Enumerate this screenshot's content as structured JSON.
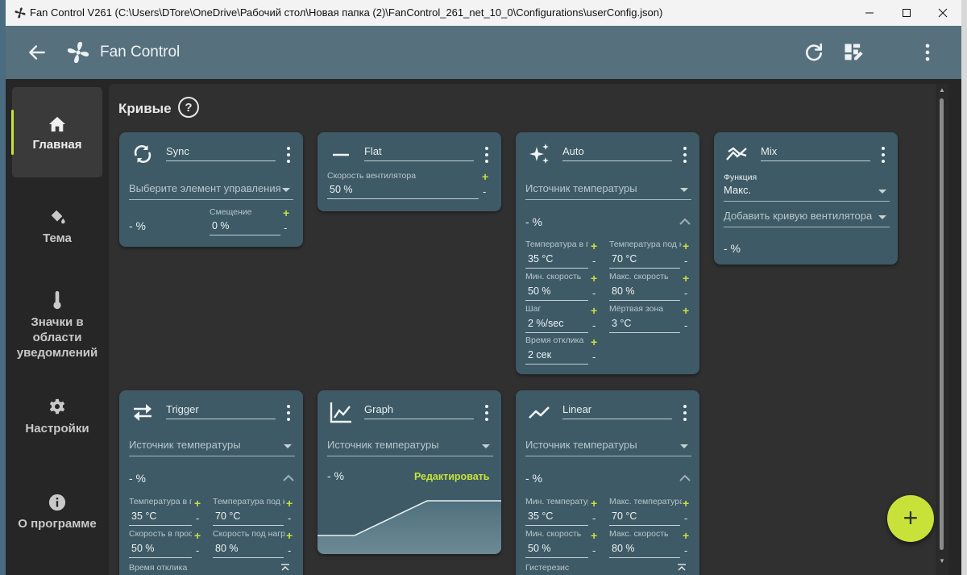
{
  "window": {
    "title": "Fan Control V261 (C:\\Users\\DTore\\OneDrive\\Рабочий стол\\Новая папка (2)\\FanControl_261_net_10_0\\Configurations\\userConfig.json)"
  },
  "appbar": {
    "title": "Fan Control"
  },
  "sidebar": {
    "items": [
      {
        "label": "Главная",
        "icon": "home-icon"
      },
      {
        "label": "Тема",
        "icon": "paint-bucket-icon"
      },
      {
        "label": "Значки в области уведомлений",
        "icon": "thermometer-icon"
      },
      {
        "label": "Настройки",
        "icon": "gear-icon"
      },
      {
        "label": "О программе",
        "icon": "info-icon"
      }
    ]
  },
  "main": {
    "heading": "Кривые",
    "help": "?"
  },
  "cards": {
    "sync": {
      "name": "Sync",
      "control_placeholder": "Выберите элемент управления",
      "pct": "- %",
      "offset_label": "Смещение",
      "offset_value": "0 %"
    },
    "flat": {
      "name": "Flat",
      "speed_label": "Скорость вентилятора",
      "speed_value": "50 %"
    },
    "auto": {
      "name": "Auto",
      "source_placeholder": "Источник температуры",
      "pct": "- %",
      "temp_idle_label": "Температура в г",
      "temp_idle_value": "35 °C",
      "temp_load_label": "Температура под н",
      "temp_load_value": "70 °C",
      "min_speed_label": "Мин. скорость",
      "min_speed_value": "50 %",
      "max_speed_label": "Макс. скорость",
      "max_speed_value": "80 %",
      "step_label": "Шаг",
      "step_value": "2 %/sec",
      "deadband_label": "Мёртвая зона",
      "deadband_value": "3 °C",
      "response_label": "Время отклика",
      "response_value": "2 сек"
    },
    "mix": {
      "name": "Mix",
      "function_label": "Функция",
      "function_value": "Макс.",
      "add_curve_placeholder": "Добавить кривую вентилятора",
      "pct": "- %"
    },
    "trigger": {
      "name": "Trigger",
      "source_placeholder": "Источник температуры",
      "pct": "- %",
      "temp_idle_label": "Температура в п",
      "temp_idle_value": "35 °C",
      "temp_load_label": "Температура под н",
      "temp_load_value": "70 °C",
      "speed_idle_label": "Скорость в прос",
      "speed_idle_value": "50 %",
      "speed_load_label": "Скорость под нагр",
      "speed_load_value": "80 %",
      "response_label": "Время отклика"
    },
    "graph": {
      "name": "Graph",
      "source_placeholder": "Источник температуры",
      "pct": "- %",
      "edit_label": "Редактировать"
    },
    "linear": {
      "name": "Linear",
      "source_placeholder": "Источник температуры",
      "pct": "- %",
      "min_temp_label": "Мин. температура",
      "min_temp_value": "35 °C",
      "max_temp_label": "Макс. температура",
      "max_temp_value": "70 °C",
      "min_speed_label": "Мин. скорость",
      "min_speed_value": "50 %",
      "max_speed_label": "Макс. скорость",
      "max_speed_value": "80 %",
      "hysteresis_label": "Гистерезис"
    }
  },
  "fab": {
    "label": "+"
  },
  "colors": {
    "accent": "#c9e23a",
    "card": "#3d5a66",
    "header": "#56717d"
  }
}
